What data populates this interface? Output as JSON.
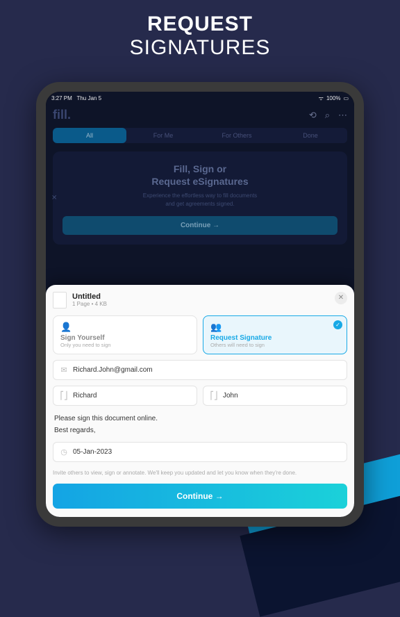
{
  "headline": {
    "line1": "REQUEST",
    "line2": "SIGNATURES"
  },
  "statusbar": {
    "time": "3:27 PM",
    "date": "Thu Jan 5",
    "wifi": "􀙇",
    "battery": "100%"
  },
  "app": {
    "logo": "fill.",
    "tabs": [
      "All",
      "For Me",
      "For Others",
      "Done"
    ],
    "hero_title_l1": "Fill, Sign or",
    "hero_title_l2": "Request eSignatures",
    "hero_sub_l1": "Experience the effortless way to fill documents",
    "hero_sub_l2": "and get agreements signed.",
    "hero_btn": "Continue →"
  },
  "sheet": {
    "doc_title": "Untitled",
    "doc_meta": "1 Page • 4 KB",
    "options": [
      {
        "title": "Sign Yourself",
        "sub": "Only you need to sign",
        "selected": false
      },
      {
        "title": "Request Signature",
        "sub": "Others will need to sign",
        "selected": true
      }
    ],
    "email": "Richard.John@gmail.com",
    "first_name": "Richard",
    "last_name": "John",
    "message_l1": "Please sign this document online.",
    "message_l2": "Best regards,",
    "date": "05-Jan-2023",
    "help": "Invite others to view, sign or annotate. We'll keep you updated and let you know when they're done.",
    "continue": "Continue →"
  }
}
